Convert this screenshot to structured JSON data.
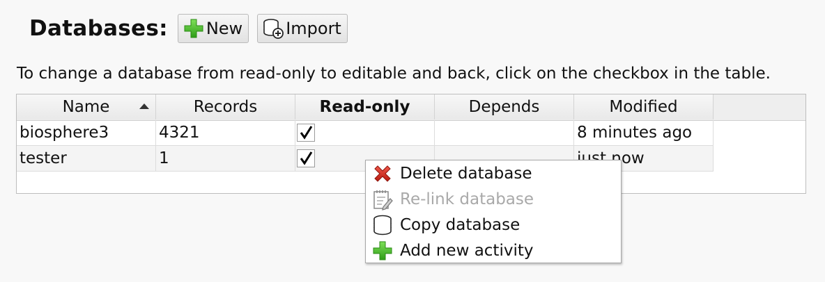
{
  "header": {
    "title": "Databases:",
    "new_label": "New",
    "import_label": "Import"
  },
  "hint": "To change a database from read-only to editable and back, click on the checkbox in the table.",
  "table": {
    "columns": [
      "Name",
      "Records",
      "Read-only",
      "Depends",
      "Modified"
    ],
    "sorted_column": "Name",
    "sort_direction": "ascending",
    "rows": [
      {
        "name": "biosphere3",
        "records": "4321",
        "read_only": true,
        "depends": "",
        "modified": "8 minutes ago"
      },
      {
        "name": "tester",
        "records": "1",
        "read_only": true,
        "depends": "",
        "modified": "just now"
      }
    ]
  },
  "context_menu": {
    "items": [
      {
        "label": "Delete database",
        "icon": "delete-icon",
        "enabled": true
      },
      {
        "label": "Re-link database",
        "icon": "relink-icon",
        "enabled": false
      },
      {
        "label": "Copy database",
        "icon": "database-icon",
        "enabled": true
      },
      {
        "label": "Add new activity",
        "icon": "add-icon",
        "enabled": true
      }
    ]
  },
  "colors": {
    "selection": "#2f8ac9",
    "add_green": "#3cb521",
    "delete_red": "#d0281c",
    "disabled_text": "#a9a9a9"
  }
}
